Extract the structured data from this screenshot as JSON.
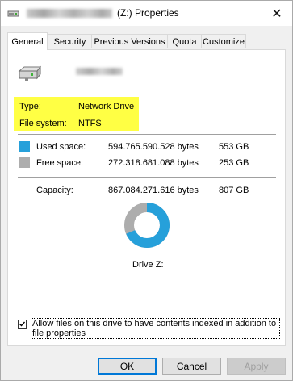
{
  "window": {
    "title_suffix": "(Z:) Properties",
    "close_glyph": "✕"
  },
  "tabs": [
    {
      "label": "General",
      "active": true
    },
    {
      "label": "Security"
    },
    {
      "label": "Previous Versions"
    },
    {
      "label": "Quota"
    },
    {
      "label": "Customize"
    }
  ],
  "general": {
    "type_label": "Type:",
    "type_value": "Network Drive",
    "fs_label": "File system:",
    "fs_value": "NTFS",
    "used_label": "Used space:",
    "used_bytes": "594.765.590.528 bytes",
    "used_gb": "553 GB",
    "free_label": "Free space:",
    "free_bytes": "272.318.681.088 bytes",
    "free_gb": "253 GB",
    "capacity_label": "Capacity:",
    "capacity_bytes": "867.084.271.616 bytes",
    "capacity_gb": "807 GB",
    "drive_caption": "Drive Z:",
    "used_fraction": 0.686,
    "colors": {
      "used": "#26a0da",
      "free": "#adadad",
      "highlight": "#ffff44"
    },
    "index_checkbox_label": "Allow files on this drive to have contents indexed in addition to file properties",
    "index_checked": true
  },
  "buttons": {
    "ok": "OK",
    "cancel": "Cancel",
    "apply": "Apply"
  },
  "icons": [
    "drive-icon",
    "close-icon",
    "checkmark-icon"
  ]
}
